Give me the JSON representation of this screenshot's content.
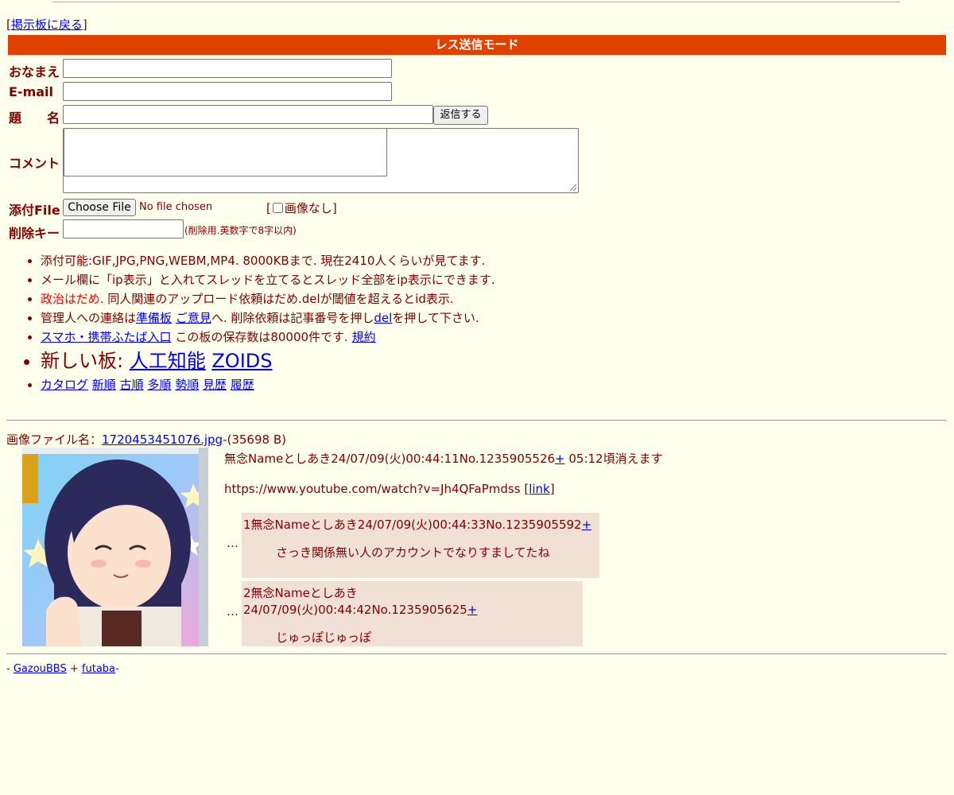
{
  "nav": {
    "back_link": "掲示板に戻る",
    "bracket_open": "[",
    "bracket_close": "]"
  },
  "mode_title": "レス送信モード",
  "form": {
    "name_label": "おなまえ",
    "email_label": "E-mail",
    "subject_label": "題　　名",
    "submit_label": "返信する",
    "comment_label": "コメント",
    "file_label": "添付File",
    "file_button": "Choose File",
    "file_status": "No file chosen",
    "noimage_label": "画像なし",
    "delkey_label": "削除キー",
    "delkey_note": "(削除用.英数字で8字以内)"
  },
  "notes": {
    "line1": "添付可能:GIF,JPG,PNG,WEBM,MP4. 8000KBまで. 現在2410人くらいが見てます.",
    "line2": "メール欄に「ip表示」と入れてスレッドを立てるとスレッド全部をip表示にできます.",
    "line3_red": "政治はだめ.",
    "line3_rest": " 同人関連のアップロード依頼はだめ.delが閾値を超えるとid表示.",
    "line4_a": "管理人への連絡は",
    "line4_link1": "準備板",
    "line4_link2": "ご意見",
    "line4_b": "へ. 削除依頼は記事番号を押し",
    "line4_link3": "del",
    "line4_c": "を押して下さい.",
    "line5_link": "スマホ・携帯ふたば入口",
    "line5_text": " この板の保存数は80000件です. ",
    "line5_link2": "規約",
    "line6_text": "新しい板: ",
    "line6_link1": "人工知能",
    "line6_link2": "ZOIDS",
    "links7": [
      "カタログ",
      "新順",
      "古順",
      "多順",
      "勢順",
      "見歴",
      "履歴"
    ]
  },
  "thread": {
    "image_prefix": "画像ファイル名：",
    "image_file": "1720453451076.jpg",
    "image_size": "-(35698 B)",
    "op_header": "無念Nameとしあき24/07/09(火)00:44:11No.1235905526",
    "op_plus": "+",
    "op_expire": " 05:12頃消えます",
    "op_body": "https://www.youtube.com/watch?v=Jh4QFaPmdss ",
    "op_link": "link",
    "replies": [
      {
        "dots": "…",
        "header": "1無念Nameとしあき24/07/09(火)00:44:33No.1235905592",
        "plus": "+",
        "body": "さっき関係無い人のアカウントでなりすましてたね"
      },
      {
        "dots": "…",
        "header": "2無念Nameとしあき24/07/09(火)00:44:42No.1235905625",
        "plus": "+",
        "body": "じゅっぽじゅっぽ"
      }
    ]
  },
  "footer": {
    "prefix": "- ",
    "link1": "GazouBBS",
    "sep": " + ",
    "link2": "futaba",
    "suffix": "-"
  },
  "colors": {
    "background": "#ffffee",
    "text": "#800000",
    "modebar": "#e04000",
    "reply_bg": "#f0e0d6",
    "link": "#0000ee"
  }
}
